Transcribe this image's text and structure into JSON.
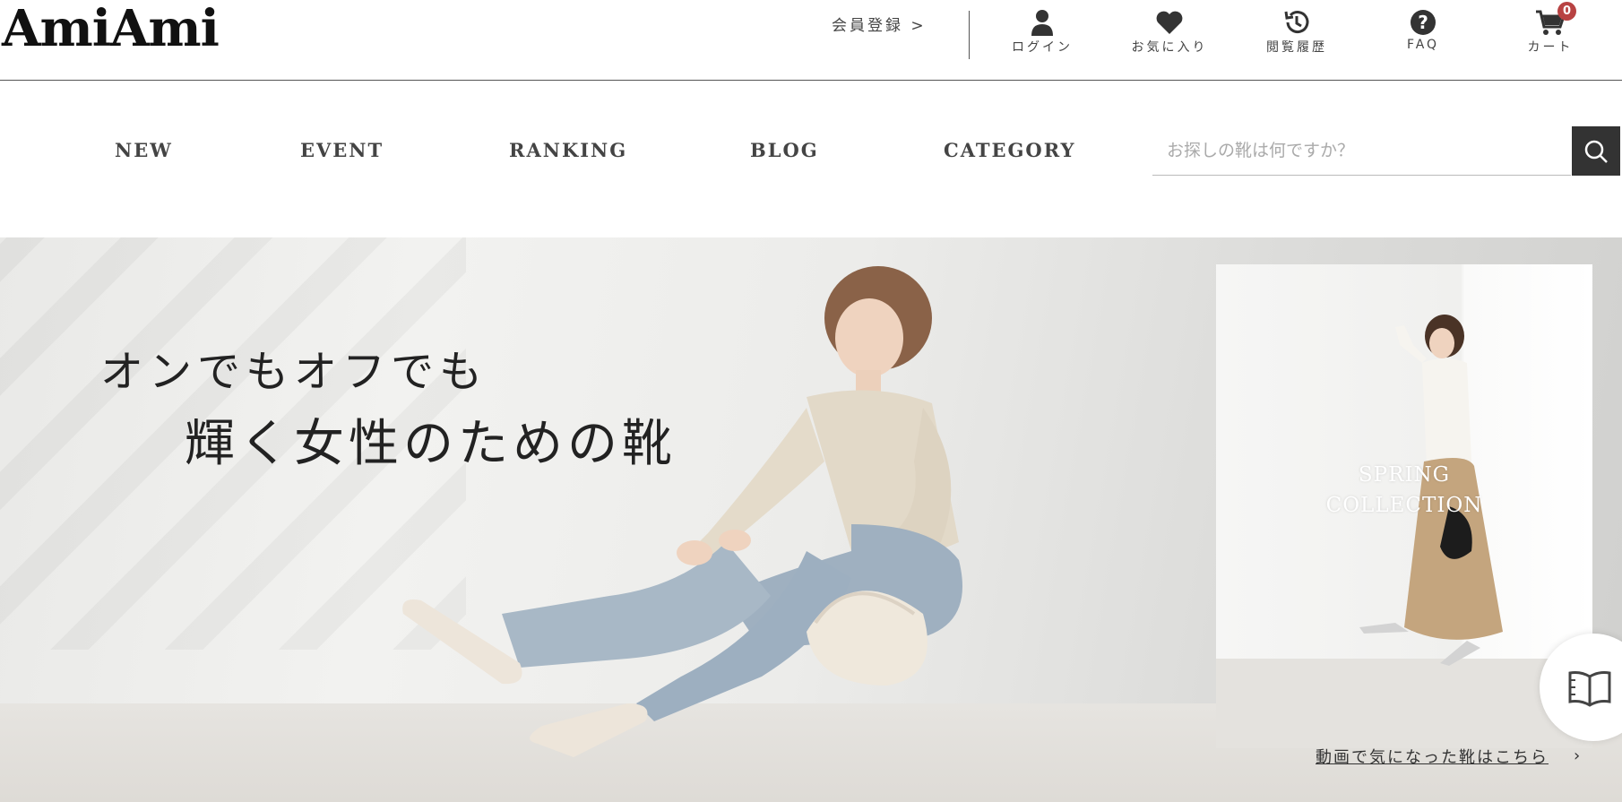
{
  "header": {
    "logo": "AmiAmi",
    "register_label": "会員登録 >",
    "buttons": [
      {
        "label": "ログイン",
        "icon": "user-icon"
      },
      {
        "label": "お気に入り",
        "icon": "heart-icon"
      },
      {
        "label": "閲覧履歴",
        "icon": "history-icon"
      },
      {
        "label": "FAQ",
        "icon": "question-icon"
      },
      {
        "label": "カート",
        "icon": "cart-icon"
      }
    ],
    "cart_count": "0"
  },
  "nav": {
    "items": [
      "NEW",
      "EVENT",
      "RANKING",
      "BLOG",
      "CATEGORY"
    ],
    "search_placeholder": "お探しの靴は何ですか？",
    "search_value": ""
  },
  "hero": {
    "catch_line1": "オンでもオフでも",
    "catch_line2": "輝く女性のための靴",
    "side_title_line1": "SPRING",
    "side_title_line2": "COLLECTION",
    "video_link": "動画で気になった靴はこちら"
  },
  "colors": {
    "badge": "#b84242",
    "search_button": "#333333"
  }
}
